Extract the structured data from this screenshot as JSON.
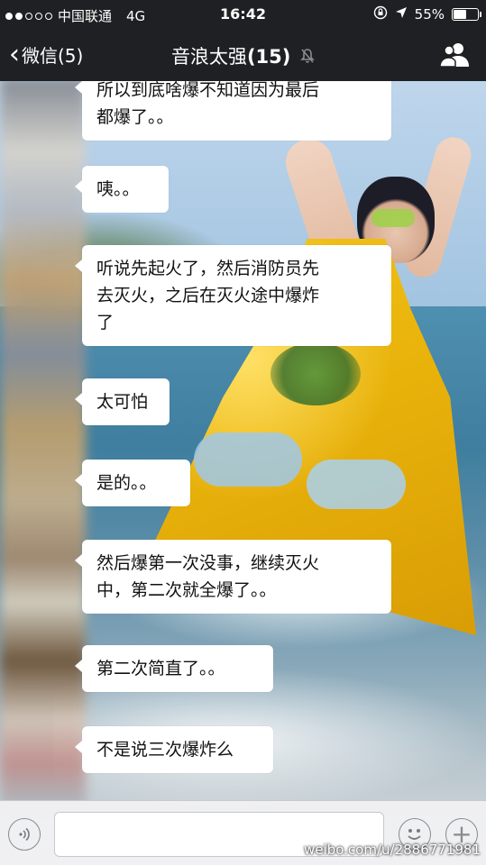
{
  "status_bar": {
    "carrier": "中国联通",
    "network": "4G",
    "time": "16:42",
    "battery_percent": "55%",
    "battery_level": 0.55,
    "signal_bars_filled": 2,
    "signal_bars_total": 5,
    "icons": [
      "orientation-lock-icon",
      "location-arrow-icon",
      "battery-icon"
    ]
  },
  "nav": {
    "back_label": "微信(5)",
    "chat_title": "音浪太强",
    "member_count": "(15)",
    "icons": [
      "chevron-left-icon",
      "mute-icon",
      "group-members-icon"
    ]
  },
  "messages": [
    {
      "text": "所以到底啥爆不知道因为最后\n都爆了。。"
    },
    {
      "text": "咦。。"
    },
    {
      "text": "听说先起火了，然后消防员先\n去灭火，之后在灭火途中爆炸\n了"
    },
    {
      "text": "太可怕"
    },
    {
      "text": "是的。。"
    },
    {
      "text": "然后爆第一次没事，继续灭火\n中，第二次就全爆了。。"
    },
    {
      "text": "第二次简直了。。"
    },
    {
      "text": "不是说三次爆炸么"
    }
  ],
  "input_bar": {
    "value": "",
    "icons": [
      "voice-icon",
      "emoji-icon",
      "plus-icon"
    ]
  },
  "watermark": "weibo.com/u/2886771981"
}
